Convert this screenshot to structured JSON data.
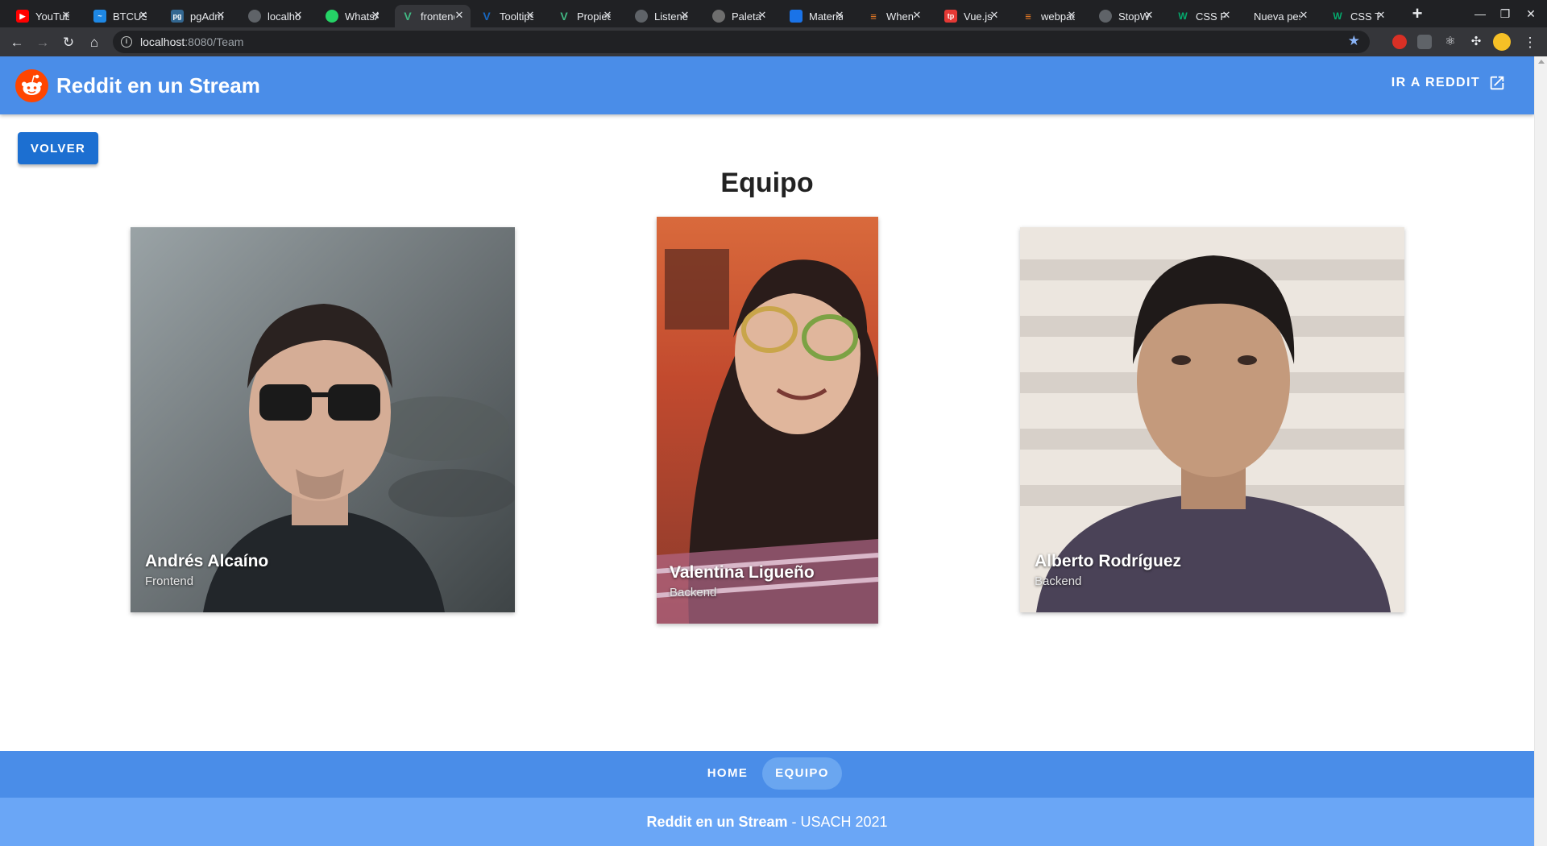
{
  "browser": {
    "tabs": [
      {
        "title": "YouTube",
        "icon": "youtube-icon",
        "color": "#ff0000"
      },
      {
        "title": "BTCUSD",
        "icon": "chart-icon",
        "color": "#1e88e5"
      },
      {
        "title": "pgAdmin",
        "icon": "pgadmin-icon",
        "color": "#336791"
      },
      {
        "title": "localhost",
        "icon": "globe-icon",
        "color": "#5f6368"
      },
      {
        "title": "WhatsApp",
        "icon": "whatsapp-icon",
        "color": "#25d366"
      },
      {
        "title": "frontend",
        "icon": "vue-icon",
        "color": "#41b883"
      },
      {
        "title": "Tooltips",
        "icon": "vuetify-icon",
        "color": "#1867c0"
      },
      {
        "title": "Propiedades",
        "icon": "vue-icon",
        "color": "#41b883"
      },
      {
        "title": "Listeners",
        "icon": "globe-icon",
        "color": "#5f6368"
      },
      {
        "title": "Paleta",
        "icon": "github-icon",
        "color": "#6e6e6e"
      },
      {
        "title": "Material",
        "icon": "material-icon",
        "color": "#1a73e8"
      },
      {
        "title": "When",
        "icon": "stackoverflow-icon",
        "color": "#f48024"
      },
      {
        "title": "Vue.js",
        "icon": "tp-icon",
        "color": "#e53935"
      },
      {
        "title": "webpack",
        "icon": "stackoverflow-icon",
        "color": "#f48024"
      },
      {
        "title": "StopW",
        "icon": "globe-icon",
        "color": "#5f6368"
      },
      {
        "title": "CSS F",
        "icon": "w3schools-icon",
        "color": "#04aa6d"
      },
      {
        "title": "Nueva pestaña",
        "icon": "",
        "color": ""
      },
      {
        "title": "CSS T",
        "icon": "w3schools-icon",
        "color": "#04aa6d"
      }
    ],
    "address": {
      "host": "localhost",
      "path": ":8080/Team"
    }
  },
  "app": {
    "title": "Reddit en un Stream",
    "external_link_label": "IR A REDDIT",
    "brand_color": "#4a8de8",
    "logo_color": "#ff4500"
  },
  "page": {
    "back_button_label": "VOLVER",
    "heading": "Equipo"
  },
  "team": [
    {
      "name": "Andrés Alcaíno",
      "role": "Frontend"
    },
    {
      "name": "Valentina Ligueño",
      "role": "Backend"
    },
    {
      "name": "Alberto Rodríguez",
      "role": "Backend"
    }
  ],
  "footer": {
    "nav": [
      {
        "label": "HOME",
        "active": false
      },
      {
        "label": "EQUIPO",
        "active": true
      }
    ],
    "brand": "Reddit en un Stream",
    "suffix": " - USACH 2021"
  }
}
